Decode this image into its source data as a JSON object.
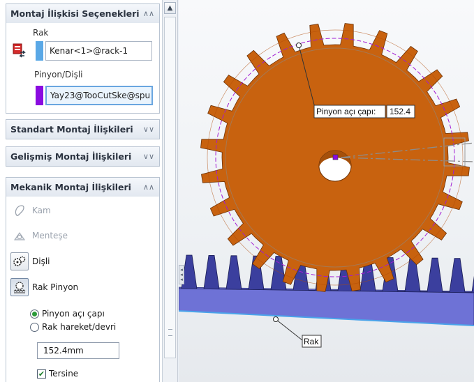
{
  "panel": {
    "group1": {
      "title": "Montaj İlişkisi Seçenekleri",
      "rack_label": "Rak",
      "rack_value": "Kenar<1>@rack-1",
      "pinion_label": "Pinyon/Dişli",
      "pinion_value": "Yay23@TooCutSke@spu",
      "rack_color": "#5aa8e6",
      "pinion_color": "#8a0be0"
    },
    "group2": {
      "title": "Standart Montaj İlişkileri"
    },
    "group3": {
      "title": "Gelişmiş Montaj İlişkileri"
    },
    "group4": {
      "title": "Mekanik Montaj İlişkileri",
      "mates": {
        "cam": "Kam",
        "hinge": "Menteşe",
        "gear": "Dişli",
        "rack_pinion": "Rak Pinyon"
      },
      "options": {
        "pitch_diameter": "Pinyon açı çapı",
        "travel_per_rev": "Rak hareket/devri"
      },
      "value": "152.4mm",
      "reverse": "Tersine"
    }
  },
  "viewport": {
    "dim_label": "Pinyon açı çapı:",
    "dim_value": "152.4",
    "rack_callout": "Rak",
    "gear_color": "#c8620f",
    "rack_color": "#3b3f9e"
  }
}
